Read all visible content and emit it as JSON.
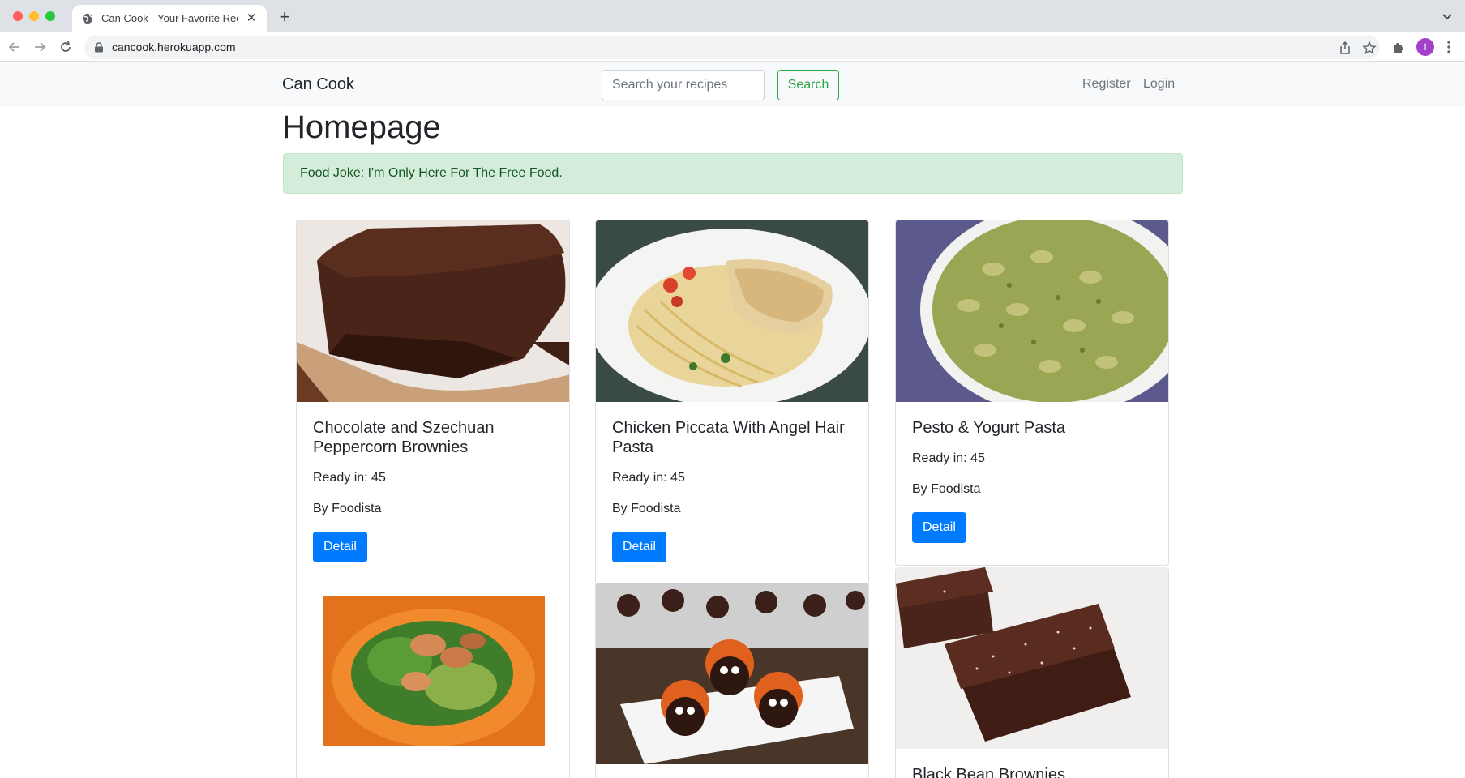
{
  "browser": {
    "tab_title": "Can Cook - Your Favorite Recipes",
    "url": "cancook.herokuapp.com",
    "profile_initial": "I"
  },
  "navbar": {
    "brand": "Can Cook",
    "search_placeholder": "Search your recipes",
    "search_button": "Search",
    "register": "Register",
    "login": "Login"
  },
  "page": {
    "title": "Homepage",
    "alert": "Food Joke: I'm Only Here For The Free Food."
  },
  "recipes": [
    {
      "title": "Chocolate and Szechuan Peppercorn Brownies",
      "ready": "Ready in: 45",
      "by": "By Foodista",
      "button": "Detail"
    },
    {
      "title": "Chicken Piccata With Angel Hair Pasta",
      "ready": "Ready in: 45",
      "by": "By Foodista",
      "button": "Detail"
    },
    {
      "title": "Pesto & Yogurt Pasta",
      "ready": "Ready in: 45",
      "by": "By Foodista",
      "button": "Detail"
    },
    {
      "title": "Black Bean Brownies"
    }
  ],
  "colors": {
    "success": "#28a745",
    "primary": "#007bff",
    "alert_bg": "#d4edda",
    "alert_text": "#155724"
  }
}
